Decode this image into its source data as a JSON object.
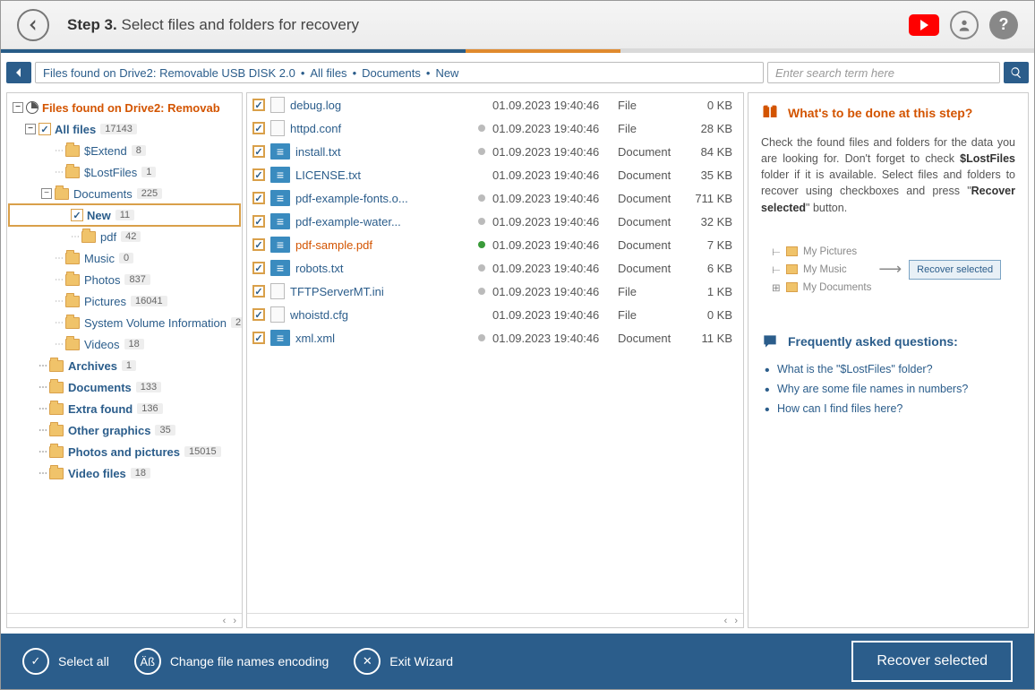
{
  "header": {
    "step_prefix": "Step 3.",
    "step_title": "Select files and folders for recovery"
  },
  "breadcrumb": {
    "root": "Files found on Drive2: Removable USB DISK 2.0",
    "p1": "All files",
    "p2": "Documents",
    "p3": "New"
  },
  "search": {
    "placeholder": "Enter search term here"
  },
  "tree": {
    "root": "Files found on Drive2: Removab",
    "allfiles": "All files",
    "allfiles_n": "17143",
    "extend": "$Extend",
    "extend_n": "8",
    "lostfiles": "$LostFiles",
    "lostfiles_n": "1",
    "documents": "Documents",
    "documents_n": "225",
    "new": "New",
    "new_n": "11",
    "pdf": "pdf",
    "pdf_n": "42",
    "music": "Music",
    "music_n": "0",
    "photos": "Photos",
    "photos_n": "837",
    "pictures": "Pictures",
    "pictures_n": "16041",
    "sysvol": "System Volume Information",
    "sysvol_n": "2",
    "videos": "Videos",
    "videos_n": "18",
    "archives": "Archives",
    "archives_n": "1",
    "docs2": "Documents",
    "docs2_n": "133",
    "extra": "Extra found",
    "extra_n": "136",
    "othergfx": "Other graphics",
    "othergfx_n": "35",
    "photospics": "Photos and pictures",
    "photospics_n": "15015",
    "videofiles": "Video files",
    "videofiles_n": "18"
  },
  "files": [
    {
      "name": "debug.log",
      "date": "01.09.2023 19:40:46",
      "type": "File",
      "size": "0 KB",
      "dot": "none",
      "ic": "plain",
      "c": "blue"
    },
    {
      "name": "httpd.conf",
      "date": "01.09.2023 19:40:46",
      "type": "File",
      "size": "28 KB",
      "dot": "grey",
      "ic": "plain",
      "c": "blue"
    },
    {
      "name": "install.txt",
      "date": "01.09.2023 19:40:46",
      "type": "Document",
      "size": "84 KB",
      "dot": "grey",
      "ic": "doc",
      "c": "blue"
    },
    {
      "name": "LICENSE.txt",
      "date": "01.09.2023 19:40:46",
      "type": "Document",
      "size": "35 KB",
      "dot": "none",
      "ic": "doc",
      "c": "blue"
    },
    {
      "name": "pdf-example-fonts.o...",
      "date": "01.09.2023 19:40:46",
      "type": "Document",
      "size": "711 KB",
      "dot": "grey",
      "ic": "doc",
      "c": "blue"
    },
    {
      "name": "pdf-example-water...",
      "date": "01.09.2023 19:40:46",
      "type": "Document",
      "size": "32 KB",
      "dot": "grey",
      "ic": "doc",
      "c": "blue"
    },
    {
      "name": "pdf-sample.pdf",
      "date": "01.09.2023 19:40:46",
      "type": "Document",
      "size": "7 KB",
      "dot": "green",
      "ic": "doc",
      "c": "orange"
    },
    {
      "name": "robots.txt",
      "date": "01.09.2023 19:40:46",
      "type": "Document",
      "size": "6 KB",
      "dot": "grey",
      "ic": "doc",
      "c": "blue"
    },
    {
      "name": "TFTPServerMT.ini",
      "date": "01.09.2023 19:40:46",
      "type": "File",
      "size": "1 KB",
      "dot": "grey",
      "ic": "plain",
      "c": "blue"
    },
    {
      "name": "whoistd.cfg",
      "date": "01.09.2023 19:40:46",
      "type": "File",
      "size": "0 KB",
      "dot": "none",
      "ic": "plain",
      "c": "blue"
    },
    {
      "name": "xml.xml",
      "date": "01.09.2023 19:40:46",
      "type": "Document",
      "size": "11 KB",
      "dot": "grey",
      "ic": "doc",
      "c": "blue"
    }
  ],
  "help": {
    "title": "What's to be done at this step?",
    "body_a": "Check the found files and folders for the data you are looking for. Don't forget to check ",
    "body_b": "$LostFiles",
    "body_c": " folder if it is available. Select files and folders to recover using checkboxes and press \"",
    "body_d": "Recover selected",
    "body_e": "\" button.",
    "illust_a": "My Pictures",
    "illust_b": "My Music",
    "illust_c": "My Documents",
    "illust_btn": "Recover selected",
    "faq_title": "Frequently asked questions:",
    "faq1": "What is the \"$LostFiles\" folder?",
    "faq2": "Why are some file names in numbers?",
    "faq3": "How can I find files here?"
  },
  "footer": {
    "selectall": "Select all",
    "encoding": "Change file names encoding",
    "exit": "Exit Wizard",
    "recover": "Recover selected"
  }
}
